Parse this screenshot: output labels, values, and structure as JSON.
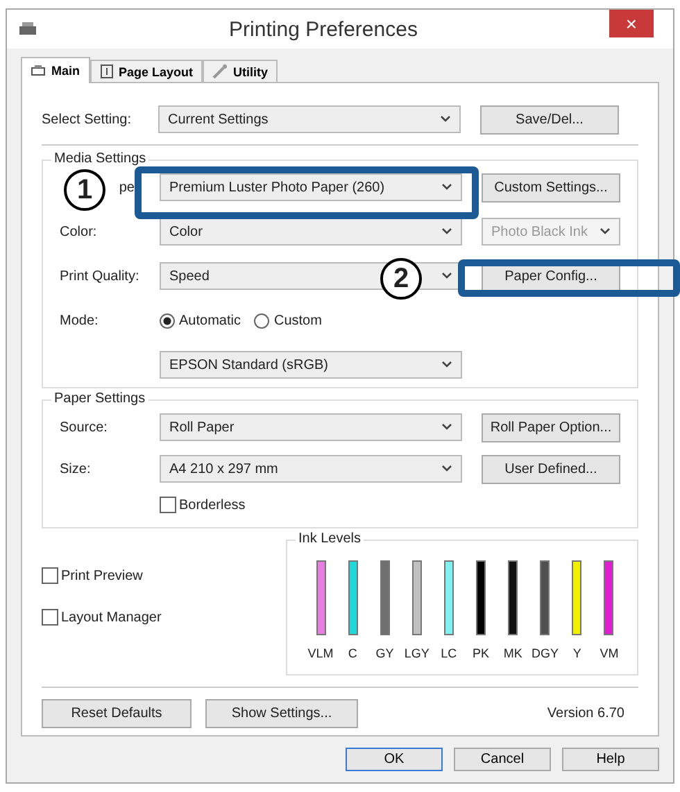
{
  "window": {
    "title": "Printing Preferences",
    "close": "×"
  },
  "tabs": [
    {
      "label": "Main",
      "selected": true
    },
    {
      "label": "Page Layout",
      "selected": false
    },
    {
      "label": "Utility",
      "selected": false
    }
  ],
  "select_setting": {
    "label": "Select Setting:",
    "value": "Current Settings",
    "button": "Save/Del..."
  },
  "media_settings": {
    "legend": "Media Settings",
    "media_type": {
      "label": "pe",
      "value": "Premium Luster Photo Paper (260)",
      "button": "Custom Settings..."
    },
    "color": {
      "label": "Color:",
      "value": "Color",
      "side": {
        "value": "Photo Black Ink",
        "disabled": true
      }
    },
    "print_quality": {
      "label": "Print Quality:",
      "value": "Speed",
      "button": "Paper Config..."
    },
    "mode": {
      "label": "Mode:",
      "options": [
        {
          "label": "Automatic",
          "selected": true
        },
        {
          "label": "Custom",
          "selected": false
        }
      ],
      "value": "EPSON Standard (sRGB)"
    }
  },
  "paper_settings": {
    "legend": "Paper Settings",
    "source": {
      "label": "Source:",
      "value": "Roll Paper",
      "button": "Roll Paper Option..."
    },
    "size": {
      "label": "Size:",
      "value": "A4 210 x 297 mm",
      "button": "User Defined..."
    },
    "borderless": {
      "label": "Borderless",
      "checked": false
    }
  },
  "options": [
    {
      "label": "Print Preview",
      "checked": false
    },
    {
      "label": "Layout Manager",
      "checked": false
    }
  ],
  "ink_levels": {
    "legend": "Ink Levels",
    "inks": [
      {
        "name": "VLM",
        "color": "#e680e0",
        "level": 1
      },
      {
        "name": "C",
        "color": "#20d8d8",
        "level": 1
      },
      {
        "name": "GY",
        "color": "#707070",
        "level": 1
      },
      {
        "name": "LGY",
        "color": "#c0c0c0",
        "level": 1
      },
      {
        "name": "LC",
        "color": "#80f0f0",
        "level": 1
      },
      {
        "name": "PK",
        "color": "#000000",
        "level": 1
      },
      {
        "name": "MK",
        "color": "#101010",
        "level": 1
      },
      {
        "name": "DGY",
        "color": "#505050",
        "level": 1
      },
      {
        "name": "Y",
        "color": "#f0f000",
        "level": 1
      },
      {
        "name": "VM",
        "color": "#e020d0",
        "level": 1
      }
    ]
  },
  "bottom": {
    "reset": "Reset Defaults",
    "show": "Show Settings...",
    "version": "Version 6.70"
  },
  "footer_buttons": [
    {
      "label": "OK",
      "default": true
    },
    {
      "label": "Cancel",
      "default": false
    },
    {
      "label": "Help",
      "default": false
    }
  ],
  "callouts": [
    {
      "number": "1"
    },
    {
      "number": "2"
    }
  ]
}
